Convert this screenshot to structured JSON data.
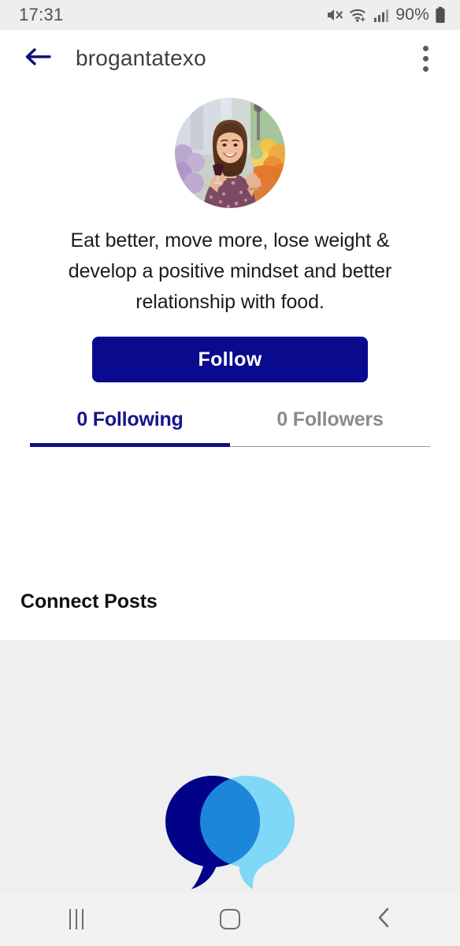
{
  "status_bar": {
    "time": "17:31",
    "battery_percent": "90%",
    "icons": [
      "volume-mute-icon",
      "wifi-icon",
      "cellular-signal-icon",
      "battery-icon"
    ],
    "background_color": "#eeeeee"
  },
  "header": {
    "back_icon": "arrow-left-icon",
    "title": "brogantatexo",
    "menu_icon": "kebab-menu-icon",
    "accent_color": "#0a0a8f"
  },
  "profile": {
    "avatar_alt": "profile-photo",
    "bio": "Eat better, move more, lose weight & develop a positive mindset and better relationship with food.",
    "follow_label": "Follow",
    "follow_button_color": "#0a0a8f"
  },
  "tabs": [
    {
      "label": "0 Following",
      "active": true,
      "color": "#16168c"
    },
    {
      "label": "0 Followers",
      "active": false,
      "color": "#8b8b8b"
    }
  ],
  "posts": {
    "section_title": "Connect Posts",
    "empty_illustration": "speech-bubbles-icon",
    "background_color": "#efefef",
    "bubble_dark_color": "#020288",
    "bubble_light_color": "#7fd8f7",
    "bubble_overlap_color": "#1e8ede"
  },
  "nav_bar": {
    "recents_icon": "recent-apps-icon",
    "home_icon": "home-icon",
    "back_icon": "back-chevron-icon",
    "background_color": "#f2f2f2"
  }
}
